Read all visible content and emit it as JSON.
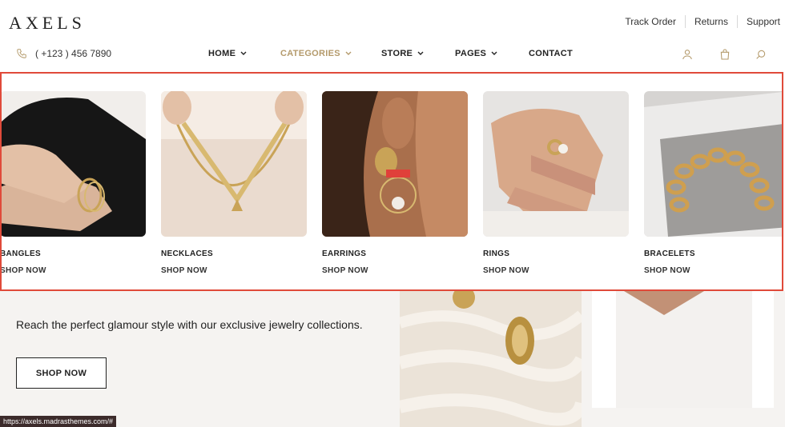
{
  "brand": {
    "logo": "AXELS"
  },
  "top_links": [
    "Track Order",
    "Returns",
    "Support"
  ],
  "phone": {
    "number": "( +123 ) 456 7890",
    "icon": "phone-icon"
  },
  "nav": {
    "items": [
      {
        "label": "HOME",
        "has_dropdown": true
      },
      {
        "label": "CATEGORIES",
        "has_dropdown": true,
        "active": true
      },
      {
        "label": "STORE",
        "has_dropdown": true
      },
      {
        "label": "PAGES",
        "has_dropdown": true
      },
      {
        "label": "CONTACT",
        "has_dropdown": false
      }
    ],
    "active_color": "#b49a6b"
  },
  "utility_icons": [
    "user-icon",
    "bag-icon",
    "search-icon"
  ],
  "megamenu": {
    "border_color": "#e04a3a",
    "categories": [
      {
        "name": "BANGLES",
        "link": "SHOP NOW"
      },
      {
        "name": "NECKLACES",
        "link": "SHOP NOW"
      },
      {
        "name": "EARRINGS",
        "link": "SHOP NOW"
      },
      {
        "name": "RINGS",
        "link": "SHOP NOW"
      },
      {
        "name": "BRACELETS",
        "link": "SHOP NOW"
      }
    ]
  },
  "hero": {
    "tagline": "Reach the perfect glamour style with our exclusive jewelry collections.",
    "button": "SHOP NOW"
  },
  "status_bar": {
    "url": "https://axels.madrasthemes.com/#"
  }
}
